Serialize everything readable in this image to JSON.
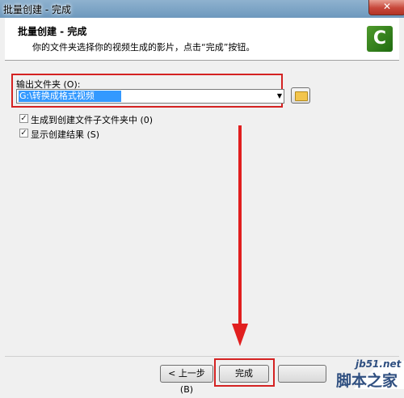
{
  "window": {
    "title": "批量创建 - 完成",
    "close_label": "✕"
  },
  "header": {
    "title": "批量创建 - 完成",
    "description": "你的文件夹选择你的视频生成的影片，点击“完成”按钮。",
    "logo_text": "C"
  },
  "output_folder": {
    "label": "输出文件夹 (O):",
    "value": "G:\\转换成格式视频"
  },
  "checkboxes": [
    {
      "label": "生成到创建文件子文件夹中 (0)",
      "checked": true
    },
    {
      "label": "显示创建结果 (S)",
      "checked": true
    }
  ],
  "footer": {
    "back_label": "< 上一步 (B)",
    "finish_label": "完成"
  },
  "watermark": {
    "url": "jb51.net",
    "text": "脚本之家"
  },
  "colors": {
    "annotation_red": "#d42222",
    "selection_blue": "#3399ff"
  }
}
